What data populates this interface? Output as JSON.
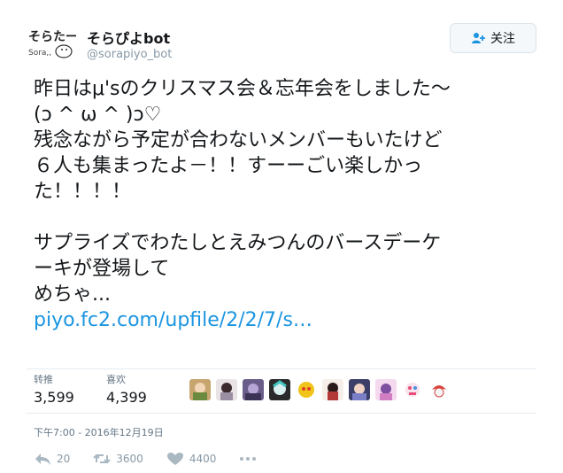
{
  "user": {
    "display_name": "そらぴよbot",
    "handle": "@sorapiyo_bot",
    "avatar_icon": "sorapiyo-logo"
  },
  "follow_button": {
    "label": "关注",
    "icon": "add-user-icon"
  },
  "tweet": {
    "lines": [
      "昨日はμ'sのクリスマス会＆忘年会をしました〜",
      "(ↄ ^ ω ^ )ↄ♡",
      "残念ながら予定が合わないメンバーもいたけど",
      "６人も集まったよ－！！すーーごい楽しかっ",
      "た！！！！",
      "",
      "サプライズでわたしとえみつんのバースデーケ",
      "ーキが登場して",
      "めちゃ..."
    ],
    "link": "piyo.fc2.com/upfile/2/2/7/s…"
  },
  "stats": {
    "retweets_label": "转推",
    "retweets_value": "3,599",
    "likes_label": "喜欢",
    "likes_value": "4,399"
  },
  "timestamp": "下午7:00 - 2016年12月19日",
  "actions": {
    "reply_count": "20",
    "retweet_count": "3600",
    "like_count": "4400"
  },
  "colors": {
    "link": "#1b95e0",
    "muted": "#8899a6"
  }
}
